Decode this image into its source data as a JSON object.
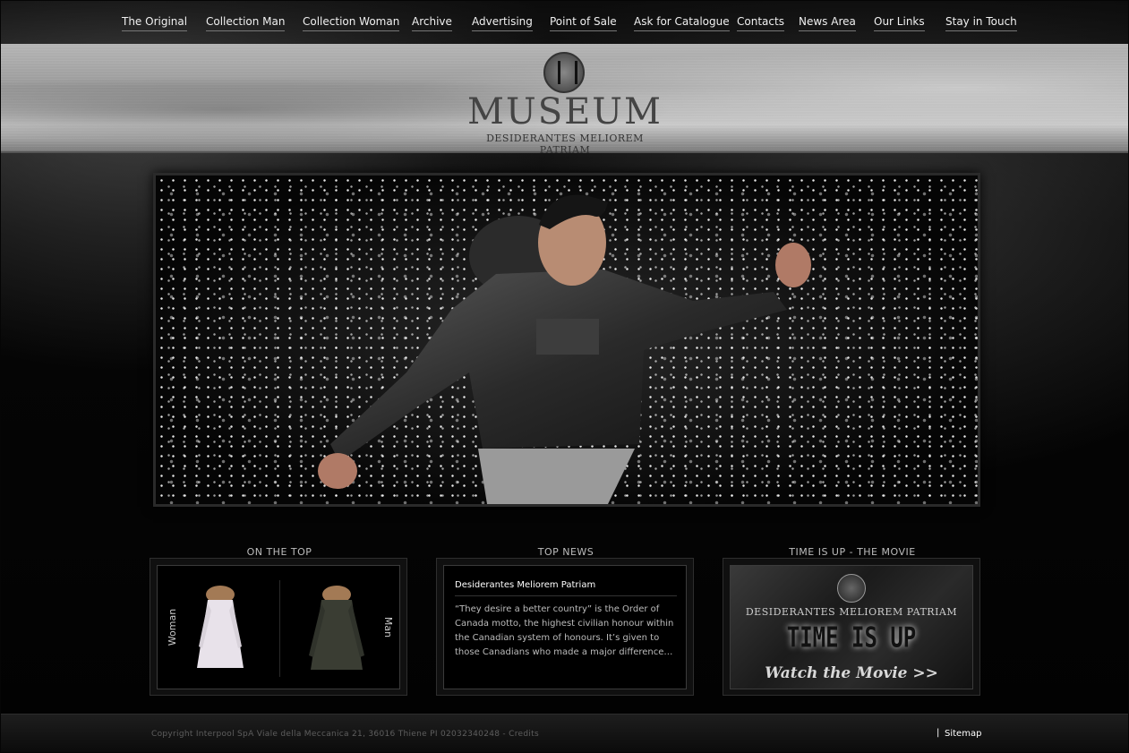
{
  "nav": {
    "items": [
      {
        "label": "The Original"
      },
      {
        "label": "Collection Man"
      },
      {
        "label": "Collection Woman"
      },
      {
        "label": "Archive"
      },
      {
        "label": "Advertising"
      },
      {
        "label": "Point of Sale"
      },
      {
        "label": "Ask for Catalogue"
      },
      {
        "label": "Contacts"
      },
      {
        "label": "News Area"
      },
      {
        "label": "Our Links"
      },
      {
        "label": "Stay in Touch"
      }
    ]
  },
  "header": {
    "brand": "MUSEUM",
    "motto": "DESIDERANTES  MELIOREM  PATRIAM"
  },
  "boxes": {
    "on_the_top": {
      "title": "ON THE TOP",
      "left_label": "Woman",
      "right_label": "Man"
    },
    "top_news": {
      "title": "TOP NEWS",
      "headline": "Desiderantes Meliorem Patriam",
      "body": "“They desire a better country” is the Order of Canada motto, the highest civilian honour within the Canadian system of honours. It’s given to those Canadians who made a major difference…"
    },
    "movie": {
      "title": "TIME IS UP - THE MOVIE",
      "motto": "DESIDERANTES  MELIOREM  PATRIAM",
      "headline": "TIME IS UP",
      "cta": "Watch the Movie >>"
    }
  },
  "footer": {
    "copyright": "Copyright Interpool SpA Viale della Meccanica 21, 36016 Thiene PI 02032340248 - Credits",
    "separator": "|",
    "sitemap": "Sitemap"
  },
  "colors": {
    "background": "#050505",
    "band": "#a8a8a8",
    "text": "#f0f0f0"
  }
}
